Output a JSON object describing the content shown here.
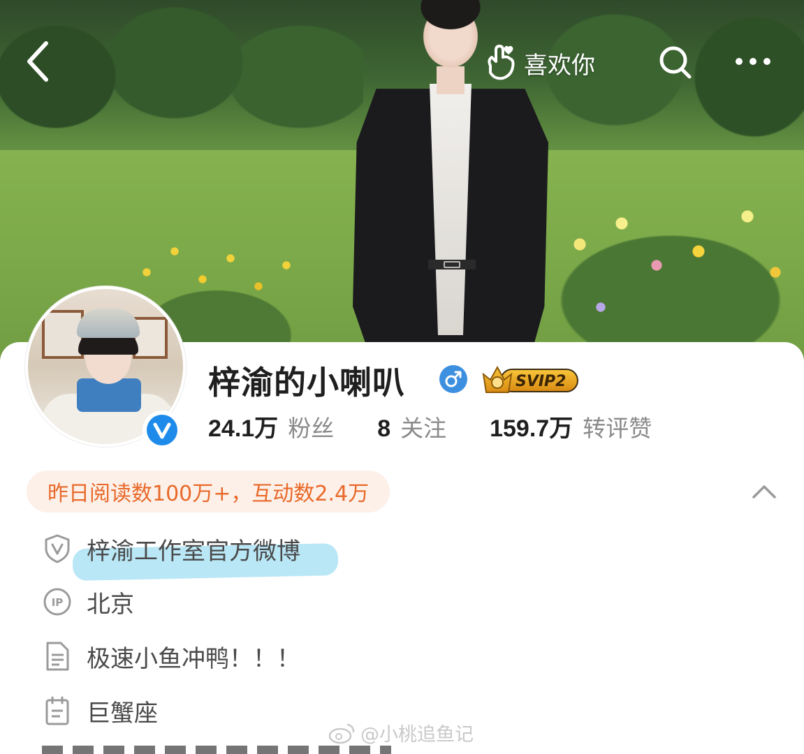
{
  "header": {
    "like_label": "喜欢你"
  },
  "profile": {
    "name": "梓渝的小喇叭",
    "badge": "SVIP2",
    "gender": "male",
    "stats": [
      {
        "value": "24.1万",
        "label": "粉丝"
      },
      {
        "value": "8",
        "label": "关注"
      },
      {
        "value": "159.7万",
        "label": "转评赞"
      }
    ],
    "highlight": "昨日阅读数100万+，互动数2.4万"
  },
  "info": {
    "verification": "梓渝工作室官方微博",
    "ip_location": "北京",
    "bio": "极速小鱼冲鸭！！！",
    "zodiac": "巨蟹座"
  },
  "watermark": "@小桃追鱼记",
  "colors": {
    "accent_orange": "#e8692a",
    "pill_bg": "#fdf0e8",
    "verified_blue": "#1e8bea",
    "gender_blue": "#3d8fe0",
    "svip_gold": "#e3a21a",
    "highlight_marker": "#80d4ee"
  },
  "icons": {
    "back": "chevron-left-icon",
    "like": "hand-heart-icon",
    "search": "search-icon",
    "more": "more-dots-icon",
    "verified": "verified-v-icon",
    "gender": "male-icon",
    "collapse": "chevron-up-icon",
    "verification_row": "shield-v-icon",
    "ip_row": "ip-icon",
    "bio_row": "document-icon",
    "zodiac_row": "calendar-icon"
  }
}
